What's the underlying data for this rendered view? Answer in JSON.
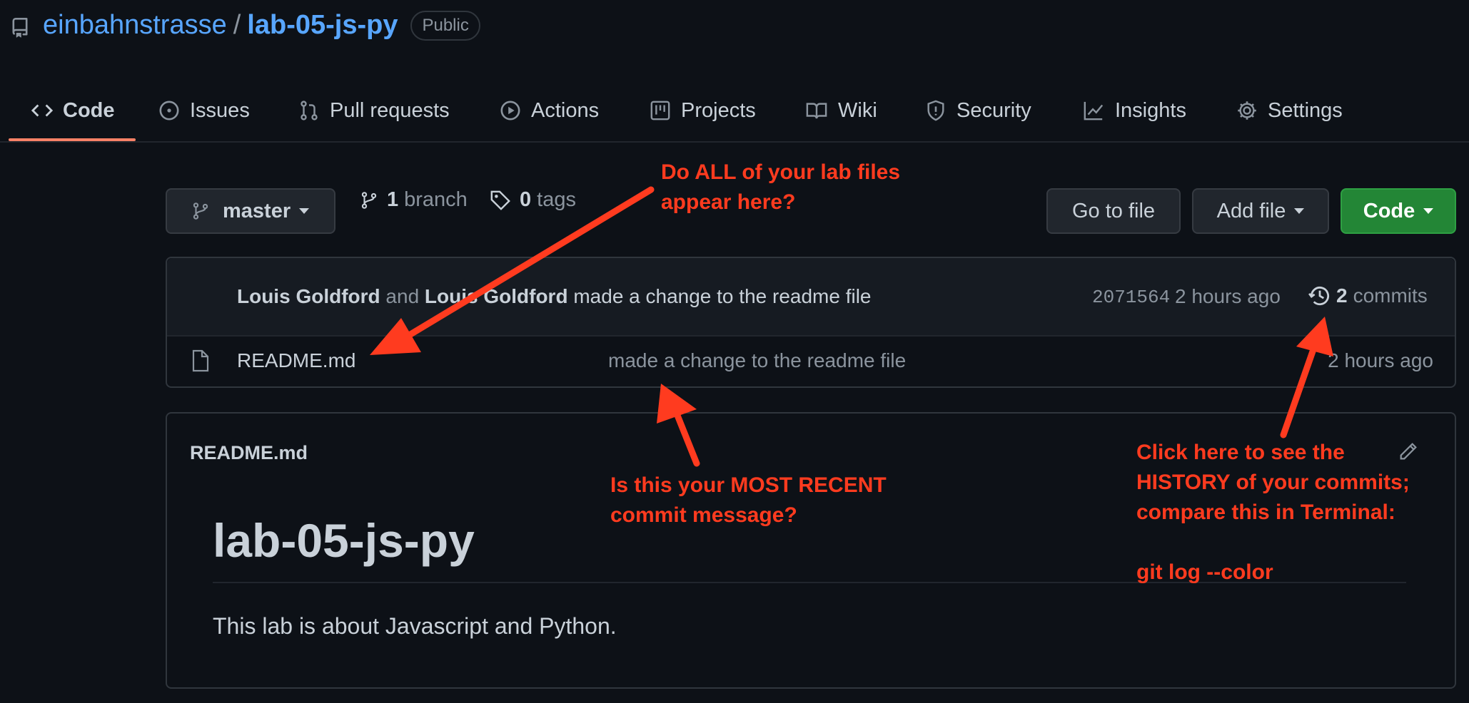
{
  "repo": {
    "owner": "einbahnstrasse",
    "separator": "/",
    "name": "lab-05-js-py",
    "visibility": "Public"
  },
  "tabs": [
    {
      "label": "Code",
      "icon": "code-icon"
    },
    {
      "label": "Issues",
      "icon": "issue-icon"
    },
    {
      "label": "Pull requests",
      "icon": "pull-request-icon"
    },
    {
      "label": "Actions",
      "icon": "play-icon"
    },
    {
      "label": "Projects",
      "icon": "project-icon"
    },
    {
      "label": "Wiki",
      "icon": "book-icon"
    },
    {
      "label": "Security",
      "icon": "shield-icon"
    },
    {
      "label": "Insights",
      "icon": "graph-icon"
    },
    {
      "label": "Settings",
      "icon": "gear-icon"
    }
  ],
  "toolbar": {
    "branch": "master",
    "branch_count": "1",
    "branch_label": "branch",
    "tag_count": "0",
    "tag_label": "tags",
    "go_to_file": "Go to file",
    "add_file": "Add file",
    "code": "Code"
  },
  "latest_commit": {
    "author1": "Louis Goldford",
    "and": "and",
    "author2": "Louis Goldford",
    "message": "made a change to the readme file",
    "sha": "2071564",
    "time": "2 hours ago",
    "commit_count": "2",
    "commits_label": "commits"
  },
  "files": [
    {
      "name": "README.md",
      "message": "made a change to the readme file",
      "time": "2 hours ago"
    }
  ],
  "readme": {
    "header": "README.md",
    "title": "lab-05-js-py",
    "body": "This lab is about Javascript and Python."
  },
  "annotations": {
    "files": "Do ALL of your lab files\nappear here?",
    "message": "Is this your MOST RECENT\ncommit message?",
    "history": "Click here to see the\nHISTORY of your commits;\ncompare this in Terminal:\n\ngit log --color"
  },
  "colors": {
    "annotation": "#ff3b1f",
    "link": "#58a6ff",
    "accent": "#f78166",
    "green": "#238636"
  }
}
